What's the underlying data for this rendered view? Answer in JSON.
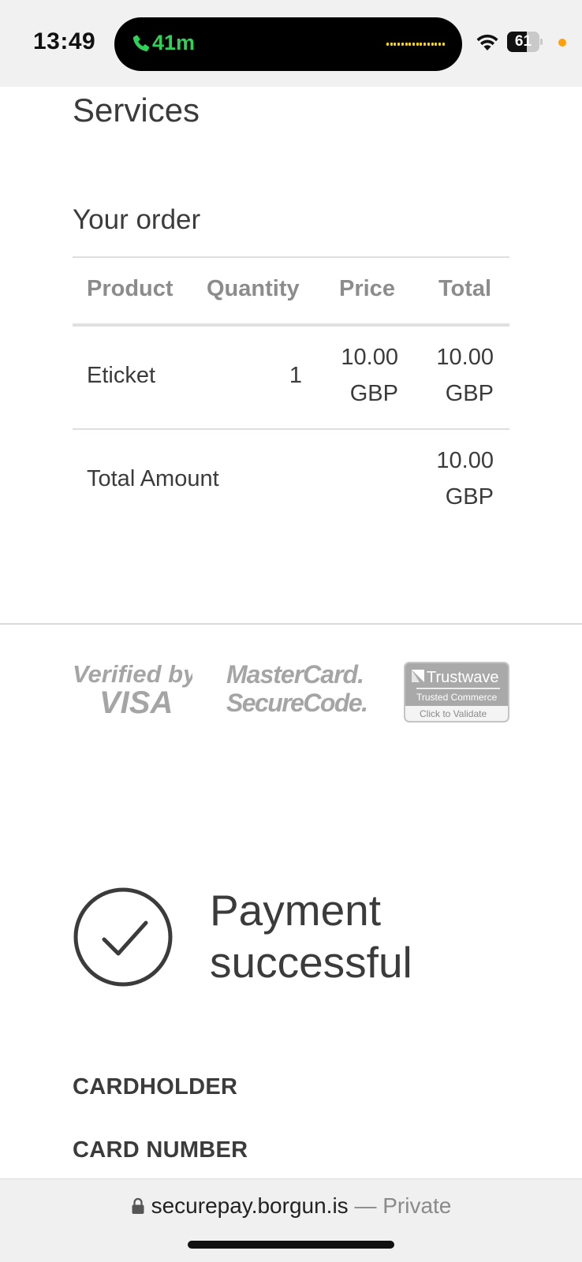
{
  "status_bar": {
    "time": "13:49",
    "call_duration": "41m",
    "battery_level": "61",
    "battery_fraction": 0.61,
    "call_color": "#30d158",
    "dot_color": "#ff9f0a"
  },
  "page": {
    "section_title": "Services",
    "order_title": "Your order",
    "table": {
      "headers": [
        "Product",
        "Quantity",
        "Price",
        "Total"
      ],
      "rows": [
        {
          "product": "Eticket",
          "quantity": "1",
          "price_amount": "10.00",
          "price_currency": "GBP",
          "total_amount": "10.00",
          "total_currency": "GBP"
        }
      ],
      "total_label": "Total Amount",
      "total_amount": "10.00",
      "total_currency": "GBP"
    },
    "badges": {
      "visa_line1": "Verified by",
      "visa_line2": "VISA",
      "mc_line1": "MasterCard.",
      "mc_line2": "SecureCode.",
      "tw_brand": "Trustwave",
      "tw_sub": "Trusted Commerce",
      "tw_cta": "Click to Validate"
    },
    "payment_status": "Payment successful",
    "cardholder_label": "CARDHOLDER",
    "card_number_label": "CARD NUMBER"
  },
  "url_bar": {
    "domain": "securepay.borgun.is",
    "separator": "—",
    "mode": "Private"
  }
}
